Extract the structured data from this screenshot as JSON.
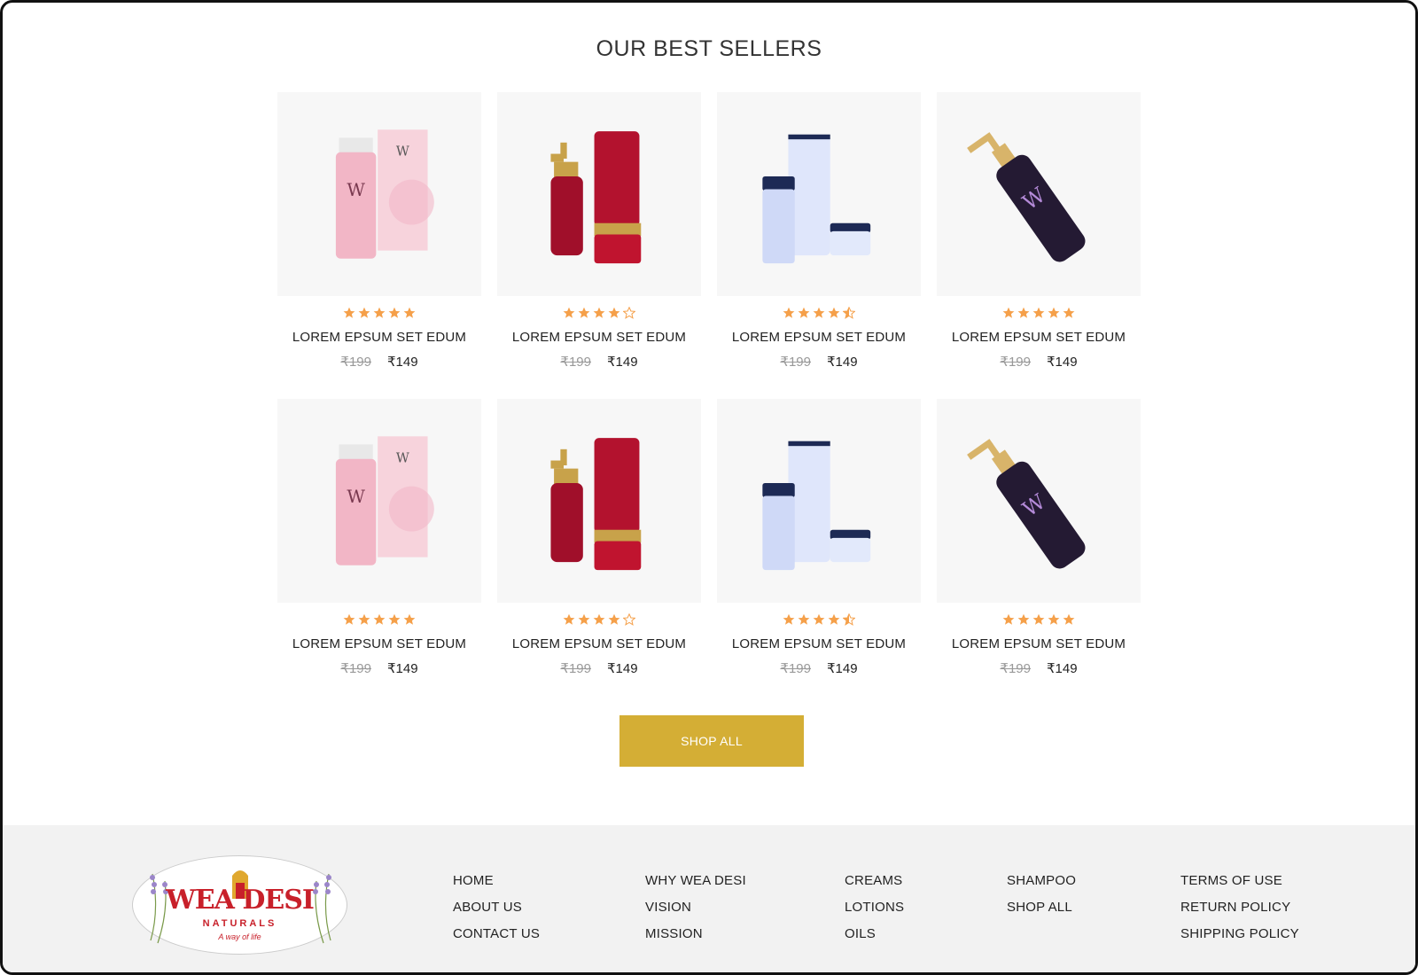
{
  "section": {
    "title": "OUR BEST SELLERS"
  },
  "products": [
    {
      "name": "LOREM EPSUM SET EDUM",
      "old_price": "₹199",
      "price": "₹149",
      "rating": 5,
      "image": "pink-serum-box"
    },
    {
      "name": "LOREM EPSUM SET EDUM",
      "old_price": "₹199",
      "price": "₹149",
      "rating": 4,
      "image": "red-bottle-tube-jar"
    },
    {
      "name": "LOREM EPSUM SET EDUM",
      "old_price": "₹199",
      "price": "₹149",
      "rating": 4.5,
      "image": "blue-tube-jars"
    },
    {
      "name": "LOREM EPSUM SET EDUM",
      "old_price": "₹199",
      "price": "₹149",
      "rating": 5,
      "image": "violet-pump-bottle"
    },
    {
      "name": "LOREM EPSUM SET EDUM",
      "old_price": "₹199",
      "price": "₹149",
      "rating": 5,
      "image": "pink-serum-box"
    },
    {
      "name": "LOREM EPSUM SET EDUM",
      "old_price": "₹199",
      "price": "₹149",
      "rating": 4,
      "image": "red-bottle-tube-jar"
    },
    {
      "name": "LOREM EPSUM SET EDUM",
      "old_price": "₹199",
      "price": "₹149",
      "rating": 4.5,
      "image": "blue-tube-jars"
    },
    {
      "name": "LOREM EPSUM SET EDUM",
      "old_price": "₹199",
      "price": "₹149",
      "rating": 5,
      "image": "violet-pump-bottle"
    }
  ],
  "cta": {
    "label": "SHOP ALL"
  },
  "footer": {
    "logo": {
      "main": "WEA DESI",
      "sub": "NATURALS",
      "tag": "A way of life"
    },
    "columns": [
      [
        "HOME",
        "ABOUT US",
        "CONTACT US"
      ],
      [
        "WHY WEA DESI",
        "VISION",
        "MISSION"
      ],
      [
        "CREAMS",
        "LOTIONS",
        "OILS"
      ],
      [
        "SHAMPOO",
        "SHOP ALL"
      ],
      [
        "TERMS OF USE",
        "RETURN POLICY",
        "SHIPPING POLICY"
      ]
    ]
  },
  "colors": {
    "accent": "#d4ae35",
    "star": "#f5a04a",
    "footer_bg": "#f2f2f2",
    "logo_red": "#c8202a"
  }
}
